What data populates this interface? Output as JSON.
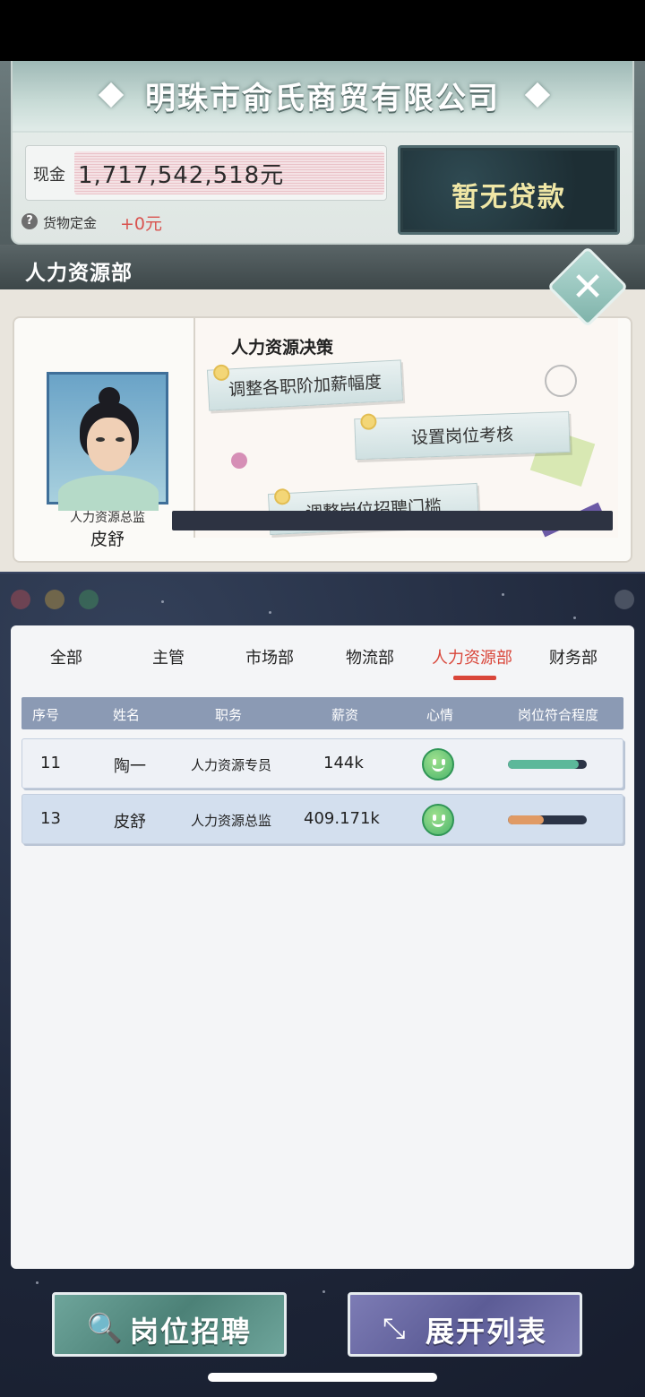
{
  "company": {
    "name": "明珠市俞氏商贸有限公司",
    "cash_label": "现金",
    "cash_value": "1,717,542,518元",
    "deposit_label": "货物定金",
    "deposit_value": "+0元",
    "loan_button": "暂无贷款"
  },
  "department": {
    "title": "人力资源部"
  },
  "manager": {
    "role": "人力资源总监",
    "name": "皮舒"
  },
  "decisions": {
    "title": "人力资源决策",
    "items": [
      "调整各职阶加薪幅度",
      "设置岗位考核",
      "调整岗位招聘门槛"
    ]
  },
  "tabs": [
    {
      "label": "全部",
      "active": false
    },
    {
      "label": "主管",
      "active": false
    },
    {
      "label": "市场部",
      "active": false
    },
    {
      "label": "物流部",
      "active": false
    },
    {
      "label": "人力资源部",
      "active": true
    },
    {
      "label": "财务部",
      "active": false
    }
  ],
  "table": {
    "headers": [
      "序号",
      "姓名",
      "职务",
      "薪资",
      "心情",
      "岗位符合程度"
    ],
    "rows": [
      {
        "id": "11",
        "name": "陶一",
        "role": "人力资源专员",
        "salary": "144k",
        "mood": "happy",
        "fit": 0.9,
        "fit_color": "#5cb89a"
      },
      {
        "id": "13",
        "name": "皮舒",
        "role": "人力资源总监",
        "salary": "409.171k",
        "mood": "happy",
        "fit": 0.45,
        "fit_color": "#e09a64"
      }
    ]
  },
  "buttons": {
    "recruit": "岗位招聘",
    "expand": "展开列表"
  },
  "icons": {
    "help": "question-icon",
    "close": "close-icon",
    "recruit": "document-search-icon",
    "expand": "expand-arrows-icon"
  }
}
